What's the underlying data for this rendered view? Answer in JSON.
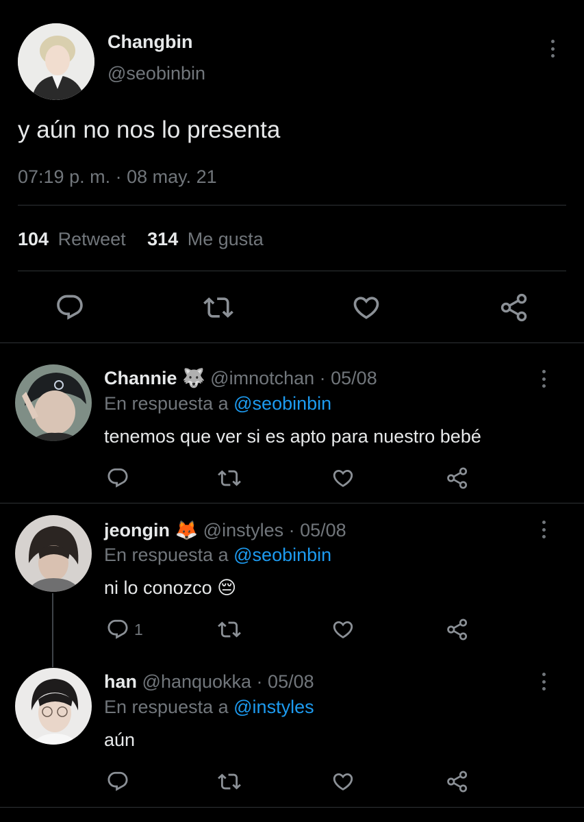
{
  "main_tweet": {
    "display_name": "Changbin",
    "handle": "@seobinbin",
    "text": "y aún no nos lo presenta",
    "timestamp": "07:19 p. m. · 08 may. 21",
    "retweets": "104",
    "retweets_label": "Retweet",
    "likes": "314",
    "likes_label": "Me gusta"
  },
  "replies": [
    {
      "display_name": "Channie",
      "emoji": "🐺",
      "handle_date": "@imnotchan · 05/08",
      "reply_prefix": "En respuesta a",
      "reply_to": "@seobinbin",
      "text": "tenemos que ver si es apto para nuestro bebé",
      "reply_count": ""
    },
    {
      "display_name": "jeongin",
      "emoji": "🦊",
      "handle_date": "@instyles · 05/08",
      "reply_prefix": "En respuesta a",
      "reply_to": "@seobinbin",
      "text": "ni lo conozco 😔",
      "reply_count": "1"
    },
    {
      "display_name": "han",
      "emoji": "",
      "handle_date": "@hanquokka · 05/08",
      "reply_prefix": "En respuesta a",
      "reply_to": "@instyles",
      "text": "aún",
      "reply_count": ""
    }
  ],
  "icons": [
    "reply-icon",
    "retweet-icon",
    "like-icon",
    "share-icon",
    "more-options-icon"
  ],
  "colors": {
    "background": "#000000",
    "text": "#e7e9ea",
    "muted": "#71767b",
    "link": "#1d9bf0",
    "divider": "#2f3336"
  }
}
